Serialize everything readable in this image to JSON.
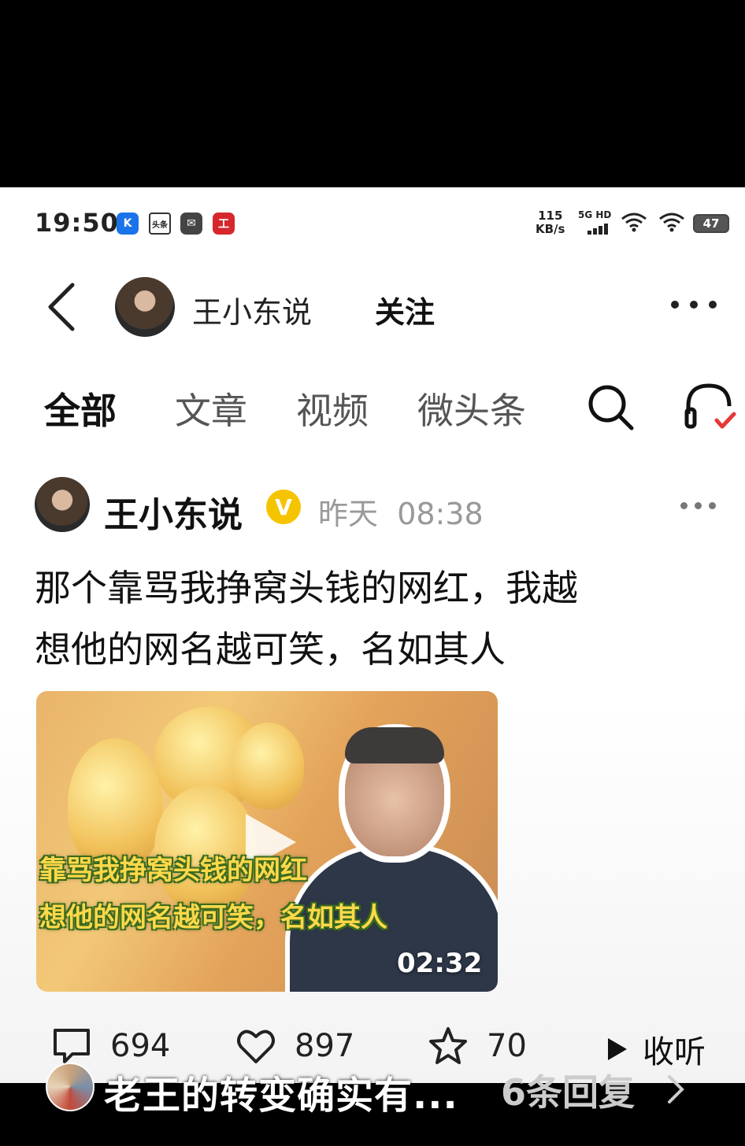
{
  "status_bar": {
    "time": "19:50",
    "app_icons": [
      "K",
      "头条",
      "✉",
      "工"
    ],
    "net_speed_value": "115",
    "net_speed_unit": "KB/s",
    "network_label": "5G HD",
    "battery": "47"
  },
  "header": {
    "account_name": "王小东说",
    "follow_label": "关注"
  },
  "tabs": [
    {
      "label": "全部",
      "active": true
    },
    {
      "label": "文章",
      "active": false
    },
    {
      "label": "视频",
      "active": false
    },
    {
      "label": "微头条",
      "active": false
    }
  ],
  "post": {
    "author": "王小东说",
    "verified_mark": "V",
    "time_day": "昨天",
    "time_clock": "08:38",
    "title_line1": "那个靠骂我挣窝头钱的网红，我越",
    "title_line2": "想他的网名越可笑，名如其人",
    "video": {
      "caption_line1": "靠骂我挣窝头钱的网红",
      "caption_line2": "想他的网名越可笑，名如其人",
      "duration": "02:32"
    },
    "actions": {
      "comments": "694",
      "likes": "897",
      "favorites": "70",
      "listen_label": "收听"
    }
  },
  "comment_preview": {
    "text": "老王的转变确实有...",
    "reply_count": "6条回复"
  },
  "colors": {
    "verified": "#f5c400",
    "listen_check": "#e53935",
    "caption_fill": "#ffd84a",
    "caption_outline": "#3a6b1e"
  }
}
